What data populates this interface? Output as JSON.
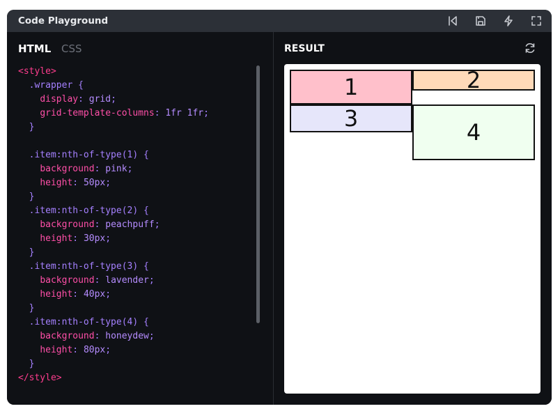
{
  "window": {
    "title": "Code Playground"
  },
  "toolbar": {
    "icons": [
      "reset-icon",
      "save-icon",
      "lightning-icon",
      "fullscreen-icon"
    ]
  },
  "editor": {
    "tabs": [
      {
        "label": "HTML",
        "active": true
      },
      {
        "label": "CSS",
        "active": false
      }
    ],
    "code": {
      "open_tag": "<style>",
      "close_tag": "</style>",
      "wrapper_selector": ".wrapper {",
      "wrapper_display_prop": "display",
      "wrapper_display_val": "grid",
      "wrapper_gtc_prop": "grid-template-columns",
      "wrapper_gtc_val": "1fr 1fr",
      "close_brace": "}",
      "items": [
        {
          "selector": ".item:nth-of-type(1) {",
          "bg_prop": "background",
          "bg_val": "pink",
          "h_prop": "height",
          "h_val": "50px"
        },
        {
          "selector": ".item:nth-of-type(2) {",
          "bg_prop": "background",
          "bg_val": "peachpuff",
          "h_prop": "height",
          "h_val": "30px"
        },
        {
          "selector": ".item:nth-of-type(3) {",
          "bg_prop": "background",
          "bg_val": "lavender",
          "h_prop": "height",
          "h_val": "40px"
        },
        {
          "selector": ".item:nth-of-type(4) {",
          "bg_prop": "background",
          "bg_val": "honeydew",
          "h_prop": "height",
          "h_val": "80px"
        }
      ]
    }
  },
  "result": {
    "label": "RESULT",
    "items": [
      {
        "text": "1",
        "color": "#ffc0cb"
      },
      {
        "text": "2",
        "color": "#ffdab9"
      },
      {
        "text": "3",
        "color": "#e6e6fa"
      },
      {
        "text": "4",
        "color": "#f0fff0"
      }
    ]
  }
}
